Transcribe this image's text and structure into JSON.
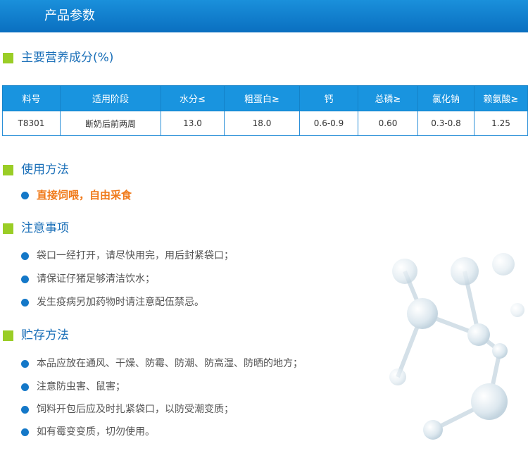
{
  "header": {
    "title": "产品参数"
  },
  "nutrition": {
    "heading": "主要营养成分(%)",
    "columns": [
      "料号",
      "适用阶段",
      "水分≤",
      "粗蛋白≥",
      "钙",
      "总磷≥",
      "氯化钠",
      "赖氨酸≥"
    ],
    "rows": [
      [
        "T8301",
        "断奶后前两周",
        "13.0",
        "18.0",
        "0.6-0.9",
        "0.60",
        "0.3-0.8",
        "1.25"
      ]
    ]
  },
  "usage": {
    "heading": "使用方法",
    "items": [
      "直接饲喂，自由采食"
    ]
  },
  "notes": {
    "heading": "注意事项",
    "items": [
      "袋口一经打开，请尽快用完，用后封紧袋口；",
      "请保证仔猪足够清洁饮水；",
      "发生疫病另加药物时请注意配伍禁忌。"
    ]
  },
  "storage": {
    "heading": "贮存方法",
    "items": [
      "本品应放在通风、干燥、防霉、防潮、防高湿、防晒的地方；",
      "注意防虫害、鼠害；",
      "饲料开包后应及时扎紧袋口，以防受潮变质；",
      "如有霉变变质，切勿使用。"
    ]
  },
  "colors": {
    "header_blue": "#0a7ccc",
    "section_square": "#9acd26",
    "heading_blue": "#1a6fb8",
    "table_header": "#1994df",
    "bullet_blue": "#1478c8",
    "highlight_orange": "#f07a1a"
  }
}
